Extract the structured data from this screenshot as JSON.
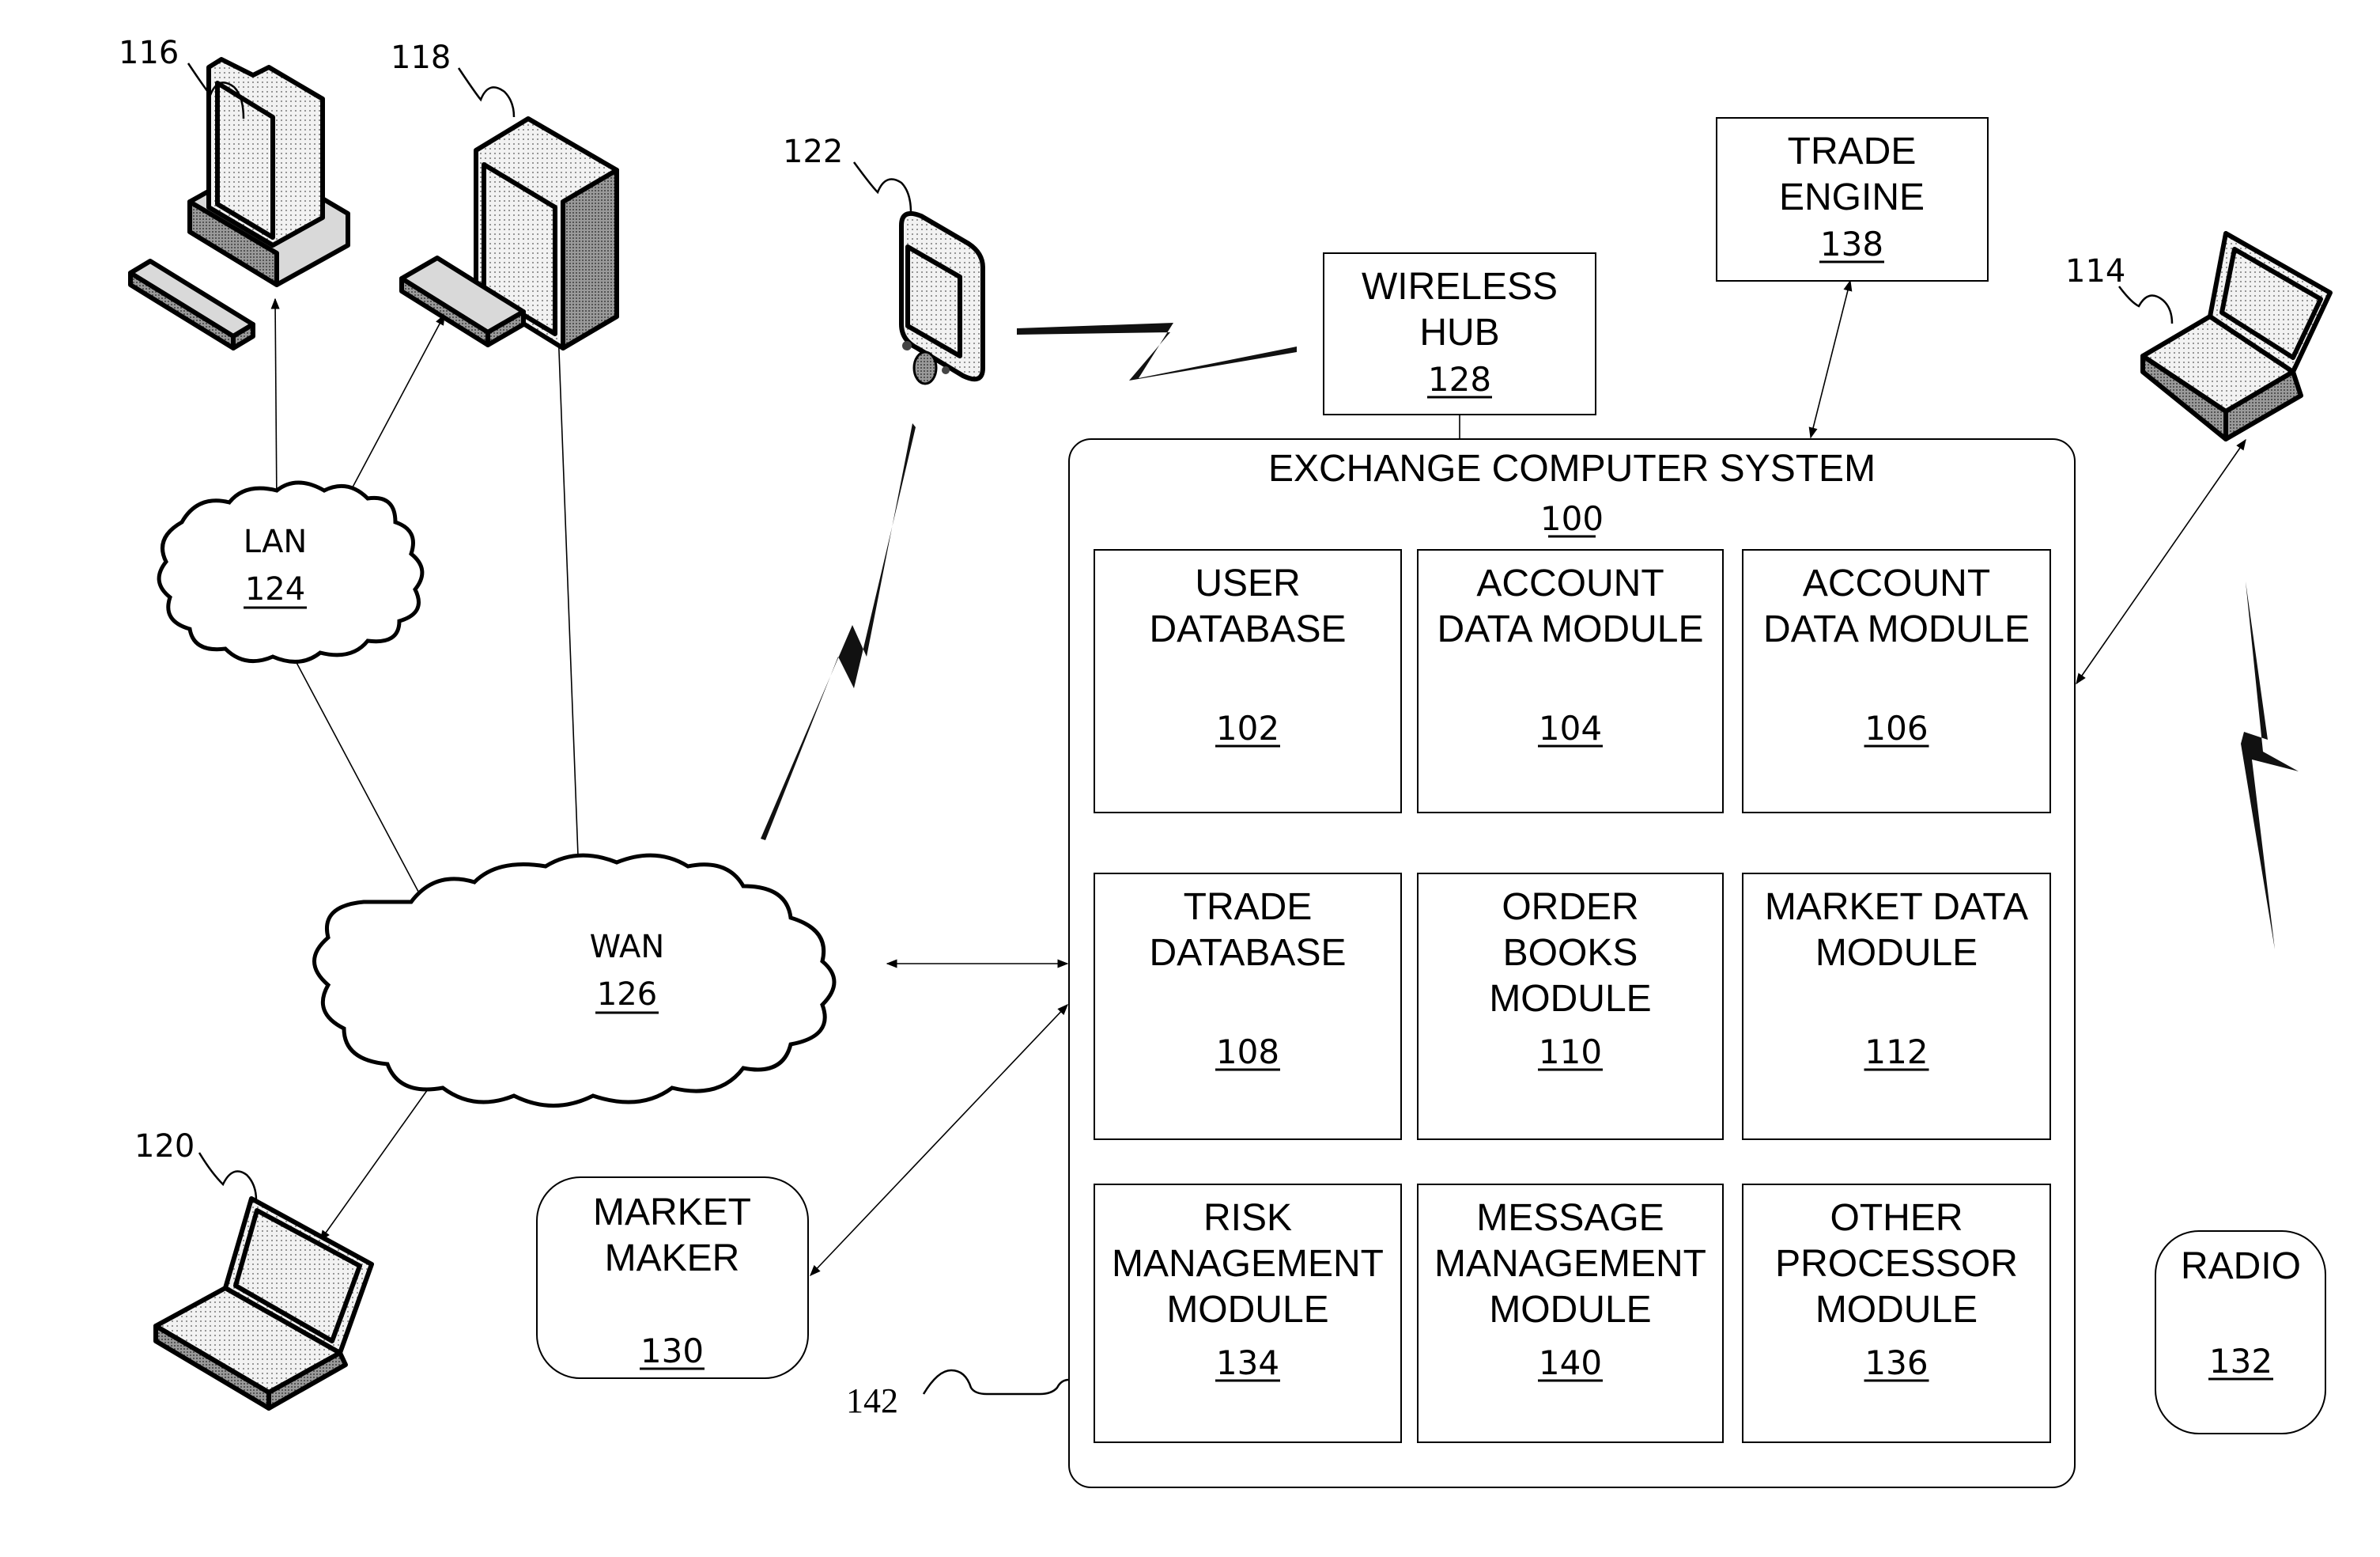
{
  "figure": {
    "exchange_system": {
      "label": "EXCHANGE COMPUTER SYSTEM",
      "ref": "100"
    },
    "modules": [
      {
        "lines": [
          "USER",
          "DATABASE"
        ],
        "ref": "102"
      },
      {
        "lines": [
          "ACCOUNT",
          "DATA MODULE"
        ],
        "ref": "104"
      },
      {
        "lines": [
          "ACCOUNT",
          "DATA MODULE"
        ],
        "ref": "106"
      },
      {
        "lines": [
          "TRADE",
          "DATABASE"
        ],
        "ref": "108"
      },
      {
        "lines": [
          "ORDER",
          "BOOKS",
          "MODULE"
        ],
        "ref": "110"
      },
      {
        "lines": [
          "MARKET DATA",
          "MODULE"
        ],
        "ref": "112"
      },
      {
        "lines": [
          "RISK",
          "MANAGEMENT",
          "MODULE"
        ],
        "ref": "134"
      },
      {
        "lines": [
          "MESSAGE",
          "MANAGEMENT",
          "MODULE"
        ],
        "ref": "140"
      },
      {
        "lines": [
          "OTHER",
          "PROCESSOR",
          "MODULE"
        ],
        "ref": "136"
      }
    ],
    "wireless_hub": {
      "lines": [
        "WIRELESS",
        "HUB"
      ],
      "ref": "128"
    },
    "trade_engine": {
      "lines": [
        "TRADE",
        "ENGINE"
      ],
      "ref": "138"
    },
    "market_maker": {
      "lines": [
        "MARKET",
        "MAKER"
      ],
      "ref": "130"
    },
    "radio": {
      "lines": [
        "RADIO"
      ],
      "ref": "132"
    },
    "lan": {
      "label": "LAN",
      "ref": "124"
    },
    "wan": {
      "label": "WAN",
      "ref": "126"
    },
    "devices": {
      "desktop_116": "116",
      "desktop_118": "118",
      "pda_122": "122",
      "laptop_114": "114",
      "laptop_120": "120"
    },
    "bracket_label": "142"
  }
}
